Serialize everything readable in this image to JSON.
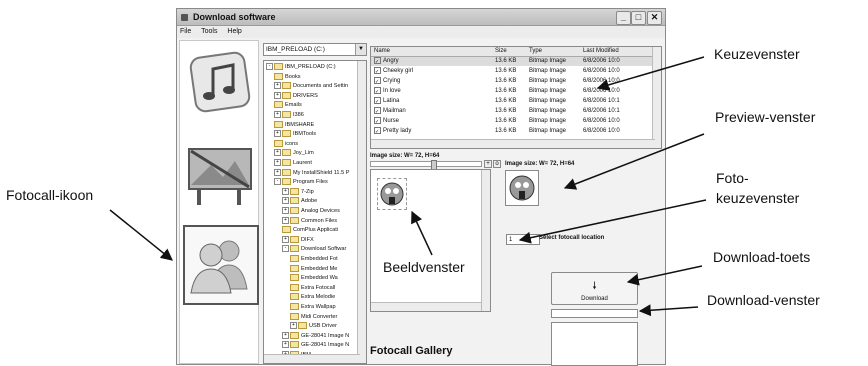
{
  "window": {
    "title": "Download software",
    "menu": [
      "File",
      "Tools",
      "Help"
    ]
  },
  "drive": {
    "selected": "IBM_PRELOAD (C:)"
  },
  "tree": {
    "items": [
      {
        "label": "IBM_PRELOAD (C:)",
        "pm": "-"
      },
      {
        "label": "Books",
        "pm": ""
      },
      {
        "label": "Documents and Settin",
        "pm": "+"
      },
      {
        "label": "DRIVERS",
        "pm": "+"
      },
      {
        "label": "Emails",
        "pm": ""
      },
      {
        "label": "I386",
        "pm": "+"
      },
      {
        "label": "IBMSHARE",
        "pm": ""
      },
      {
        "label": "IBMTools",
        "pm": "+"
      },
      {
        "label": "icons",
        "pm": ""
      },
      {
        "label": "Joy_Lim",
        "pm": "+"
      },
      {
        "label": "Laurent",
        "pm": "+"
      },
      {
        "label": "My InstallShield 11.5 P",
        "pm": "+"
      },
      {
        "label": "Program Files",
        "pm": "-"
      },
      {
        "label": "7-Zip",
        "pm": "+"
      },
      {
        "label": "Adobe",
        "pm": "+"
      },
      {
        "label": "Analog Devices",
        "pm": "+"
      },
      {
        "label": "Common Files",
        "pm": "+"
      },
      {
        "label": "ComPlus Applicati",
        "pm": ""
      },
      {
        "label": "DIFX",
        "pm": "+"
      },
      {
        "label": "Download Softwar",
        "pm": "-"
      },
      {
        "label": "Embedded Fot",
        "pm": ""
      },
      {
        "label": "Embedded Me",
        "pm": ""
      },
      {
        "label": "Embedded Wa",
        "pm": ""
      },
      {
        "label": "Extra Fotocall",
        "pm": ""
      },
      {
        "label": "Extra Melodie",
        "pm": ""
      },
      {
        "label": "Extra Wallpap",
        "pm": ""
      },
      {
        "label": "Midi Converter",
        "pm": ""
      },
      {
        "label": "USB Driver",
        "pm": "+"
      },
      {
        "label": "GE-28041 Image N",
        "pm": "+"
      },
      {
        "label": "GE-28041 Image N",
        "pm": "+"
      },
      {
        "label": "IBM",
        "pm": "+"
      }
    ]
  },
  "filelist": {
    "headers": {
      "name": "Name",
      "size": "Size",
      "type": "Type",
      "modified": "Last Modified"
    },
    "rows": [
      {
        "name": "Angry",
        "size": "13.6 KB",
        "type": "Bitmap Image",
        "modified": "6/8/2006 10:0"
      },
      {
        "name": "Cheeky girl",
        "size": "13.6 KB",
        "type": "Bitmap Image",
        "modified": "6/8/2006 10:0"
      },
      {
        "name": "Crying",
        "size": "13.6 KB",
        "type": "Bitmap Image",
        "modified": "6/8/2006 10:0"
      },
      {
        "name": "In love",
        "size": "13.6 KB",
        "type": "Bitmap Image",
        "modified": "6/8/2006 10:0"
      },
      {
        "name": "Latina",
        "size": "13.6 KB",
        "type": "Bitmap Image",
        "modified": "6/8/2006 10:1"
      },
      {
        "name": "Mailman",
        "size": "13.6 KB",
        "type": "Bitmap Image",
        "modified": "6/8/2006 10:1"
      },
      {
        "name": "Nurse",
        "size": "13.6 KB",
        "type": "Bitmap Image",
        "modified": "6/8/2006 10:0"
      },
      {
        "name": "Pretty lady",
        "size": "13.6 KB",
        "type": "Bitmap Image",
        "modified": "6/8/2006 10:0"
      }
    ]
  },
  "image_size_label": "Image size: W= 72, H=64",
  "preview_size_label": "Image size: W= 72, H=64",
  "location": {
    "value": "1",
    "label": "Select fotocall location"
  },
  "download_button": {
    "icon": "down-arrow-icon",
    "label": "Download"
  },
  "gallery_title": "Fotocall Gallery",
  "callouts": {
    "keuzevenster": "Keuzevenster",
    "preview": "Preview-venster",
    "foto1": "Foto-",
    "foto2": "keuzevenster",
    "fotocall": "Fotocall-ikoon",
    "beeld": "Beeldvenster",
    "toets": "Download-toets",
    "dlvenster": "Download-venster"
  },
  "colors": {
    "frame": "#8a8a8a",
    "panel": "#f2f2f2",
    "folder": "#f4e6a2"
  }
}
